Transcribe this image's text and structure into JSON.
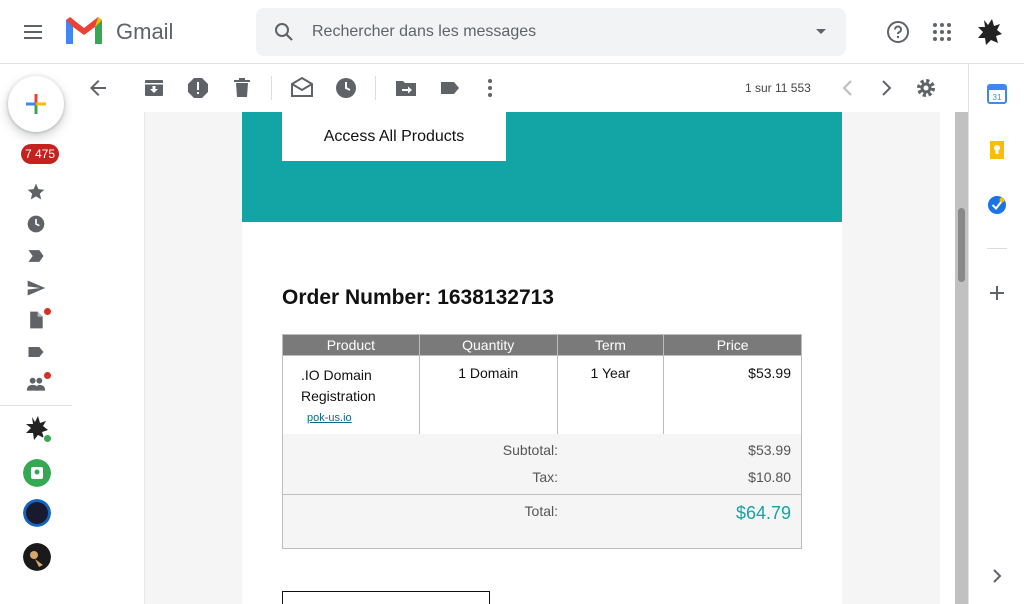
{
  "app": {
    "name": "Gmail"
  },
  "search": {
    "placeholder": "Rechercher dans les messages"
  },
  "nav": {
    "inbox_count": "7 475"
  },
  "toolbar": {
    "pager": "1 sur 11 553"
  },
  "email": {
    "access_button": "Access All Products",
    "order_title": "Order Number: 1638132713",
    "columns": [
      "Product",
      "Quantity",
      "Term",
      "Price"
    ],
    "item": {
      "product_line1": ".IO Domain",
      "product_line2": "Registration",
      "domain_link": "pok-us.io",
      "quantity": "1 Domain",
      "term": "1 Year",
      "price": "$53.99"
    },
    "totals": {
      "subtotal_label": "Subtotal:",
      "subtotal_value": "$53.99",
      "tax_label": "Tax:",
      "tax_value": "$10.80",
      "total_label": "Total:",
      "total_value": "$64.79"
    }
  },
  "colors": {
    "teal": "#13a5a5",
    "badge": "#c5221f",
    "header_gray": "#7a7a7a"
  }
}
